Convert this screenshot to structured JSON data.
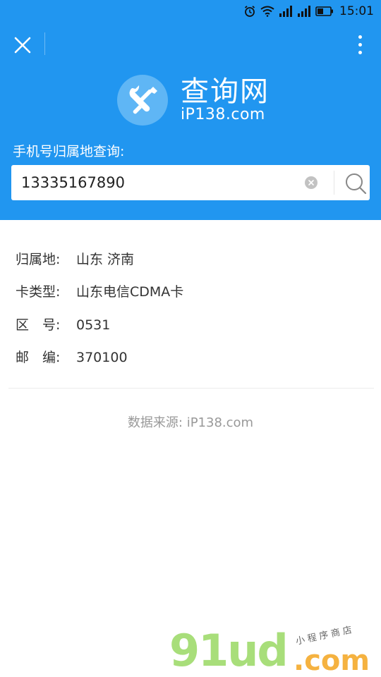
{
  "status_bar": {
    "time": "15:01",
    "icons": [
      "alarm-icon",
      "wifi-icon",
      "signal-icon",
      "signal-icon",
      "battery-icon"
    ]
  },
  "nav": {
    "close_icon": "close-icon",
    "more_icon": "more-vertical-icon"
  },
  "header": {
    "logo_icon": "tools-icon",
    "title": "查询网",
    "subtitle": "iP138.com",
    "query_label": "手机号归属地查询:",
    "background": "#2196f0"
  },
  "search": {
    "value": "13335167890",
    "clear_icon": "clear-icon",
    "search_icon": "search-icon"
  },
  "results": [
    {
      "label": "归属地:",
      "value": "山东 济南"
    },
    {
      "label": "卡类型:",
      "value": "山东电信CDMA卡"
    },
    {
      "label": "区　号:",
      "value": "0531"
    },
    {
      "label": "邮　编:",
      "value": "370100"
    }
  ],
  "source": "数据来源: iP138.com",
  "watermark": {
    "main": "91ud",
    "domain": ".com",
    "tagline": "小程序商店"
  }
}
